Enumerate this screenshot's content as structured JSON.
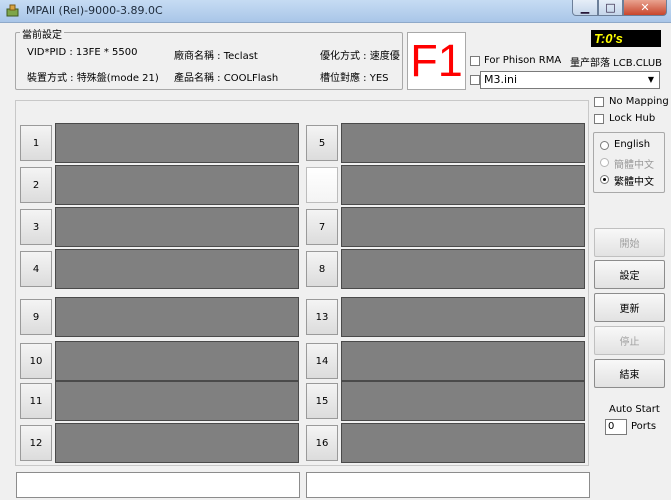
{
  "window": {
    "title": "MPAll (Rel)-9000-3.89.0C",
    "controls": {
      "minimize": "▁",
      "maximize": "□",
      "close": "✕"
    }
  },
  "current_settings": {
    "legend": "當前設定",
    "vid_pid": "VID*PID : 13FE * 5500",
    "vendor_name": "廠商名稱 : Teclast",
    "optimize_mode": "優化方式 : 速度優",
    "install_mode": "裝置方式 : 特殊盤(mode 21)",
    "product_name": "產品名稱 : COOLFlash",
    "slot_mapping": "槽位對應 : YES"
  },
  "f1_label": "F1",
  "timer": "T:0's",
  "phison_rma_label": "For Phison RMA",
  "brand_label": "量产部落 LCB.CLUB",
  "ini_select": {
    "value": "M3.ini"
  },
  "no_mapping_label": "No Mapping",
  "lock_hub_label": "Lock Hub",
  "language": {
    "english": "English",
    "simplified": "簡體中文",
    "traditional": "繁體中文"
  },
  "ports_left": [
    {
      "label": "1"
    },
    {
      "label": "2"
    },
    {
      "label": "3"
    },
    {
      "label": "4"
    },
    {
      "label": "9"
    },
    {
      "label": "10"
    },
    {
      "label": "11"
    },
    {
      "label": "12"
    }
  ],
  "ports_right": [
    {
      "label": "5"
    },
    {
      "label": ""
    },
    {
      "label": "7"
    },
    {
      "label": "8"
    },
    {
      "label": "13"
    },
    {
      "label": "14"
    },
    {
      "label": "15"
    },
    {
      "label": "16"
    }
  ],
  "actions": {
    "start": "開始",
    "settings": "設定",
    "update": "更新",
    "stop": "停止",
    "exit": "結束"
  },
  "auto_start": {
    "label": "Auto Start",
    "value": "0",
    "ports_label": "Ports"
  },
  "colors": {
    "f1": "#ff0000",
    "timer_text": "#ffff00",
    "timer_bg": "#000000",
    "port_bar": "#808080"
  }
}
